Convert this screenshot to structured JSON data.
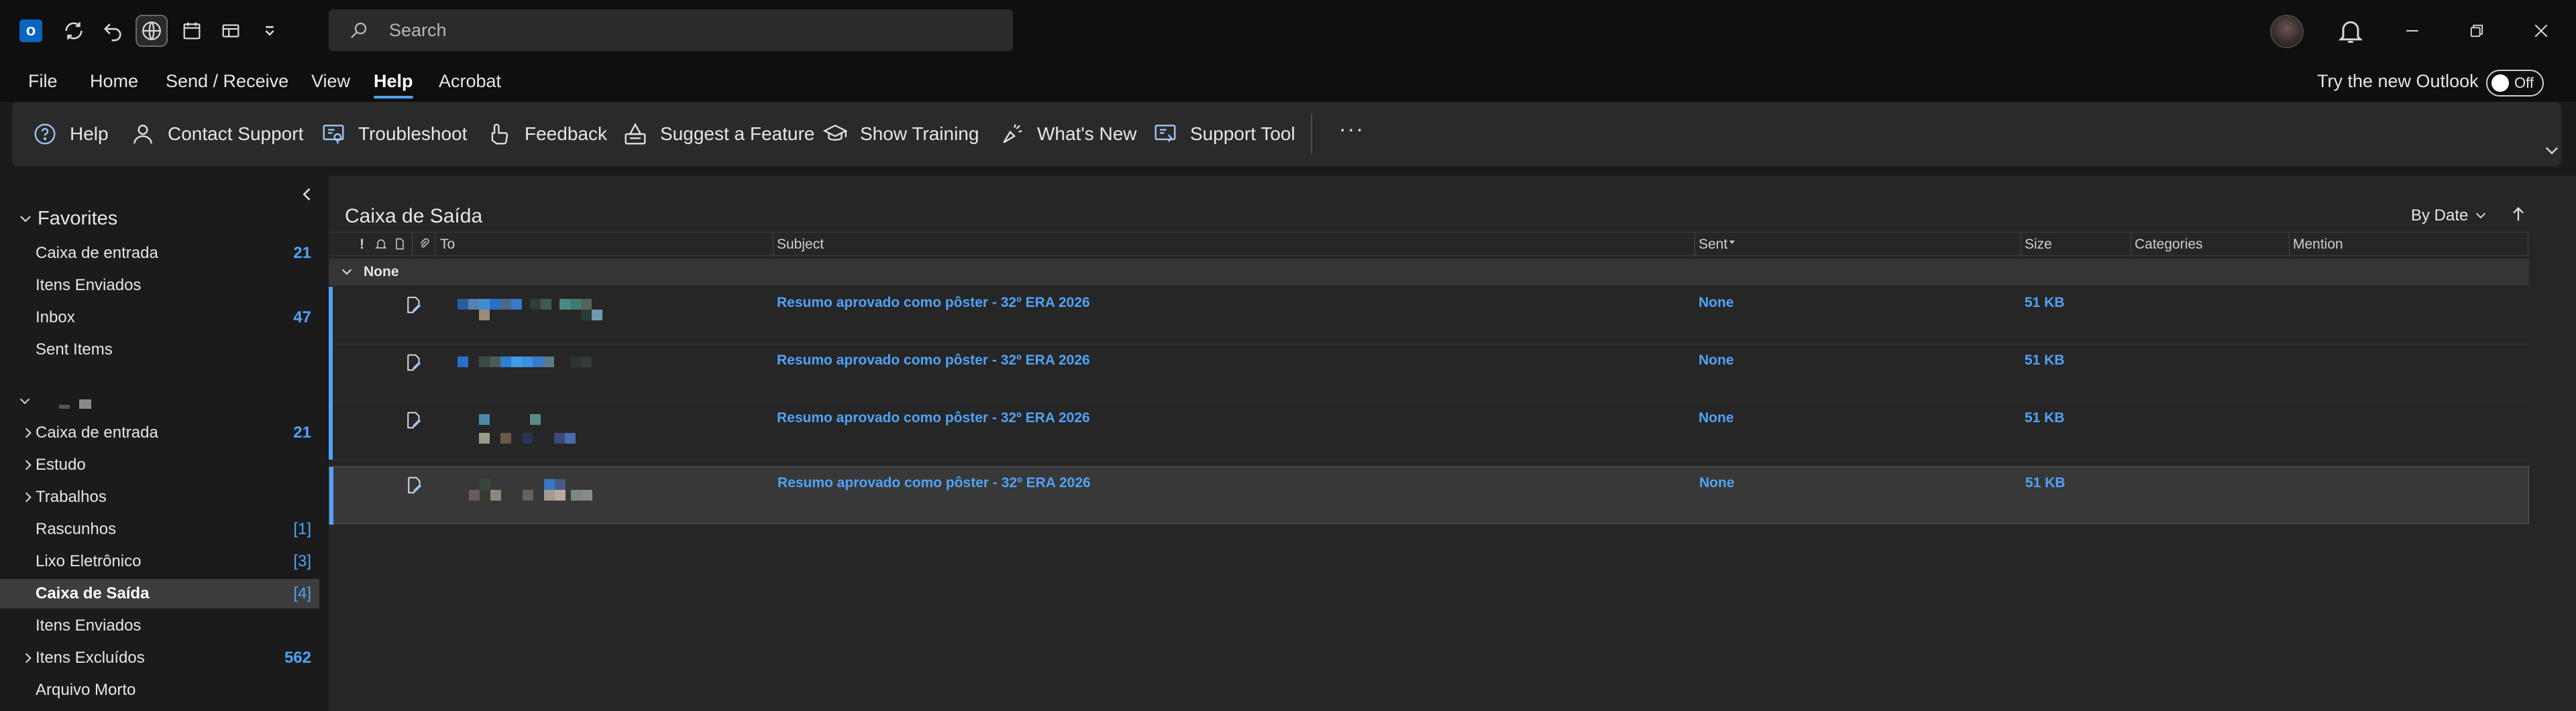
{
  "titlebar": {
    "search_placeholder": "Search"
  },
  "menu": {
    "items": [
      "File",
      "Home",
      "Send / Receive",
      "View",
      "Help",
      "Acrobat"
    ],
    "active": "Help",
    "try_new_label": "Try the new Outlook",
    "toggle_label": "Off"
  },
  "ribbon": {
    "buttons": [
      {
        "label": "Help",
        "icon": "help-circle-icon"
      },
      {
        "label": "Contact Support",
        "icon": "person-icon"
      },
      {
        "label": "Troubleshoot",
        "icon": "troubleshoot-icon"
      },
      {
        "label": "Feedback",
        "icon": "feedback-icon"
      },
      {
        "label": "Suggest a Feature",
        "icon": "suggest-feature-icon"
      },
      {
        "label": "Show Training",
        "icon": "graduation-cap-icon"
      },
      {
        "label": "What's New",
        "icon": "megaphone-icon"
      },
      {
        "label": "Support Tool",
        "icon": "support-tool-icon"
      }
    ],
    "more_label": "···"
  },
  "sidebar": {
    "favorites_label": "Favorites",
    "favorites": [
      {
        "label": "Caixa de entrada",
        "count": "21"
      },
      {
        "label": "Itens Enviados",
        "count": ""
      },
      {
        "label": "Inbox",
        "count": "47"
      },
      {
        "label": "Sent Items",
        "count": ""
      }
    ],
    "folders": [
      {
        "label": "Caixa de entrada",
        "count": "21",
        "expandable": true
      },
      {
        "label": "Estudo",
        "count": "",
        "expandable": true
      },
      {
        "label": "Trabalhos",
        "count": "",
        "expandable": true
      },
      {
        "label": "Rascunhos",
        "count": "[1]",
        "expandable": false
      },
      {
        "label": "Lixo Eletrônico",
        "count": "[3]",
        "expandable": false
      },
      {
        "label": "Caixa de Saída",
        "count": "[4]",
        "expandable": false,
        "selected": true
      },
      {
        "label": "Itens Enviados",
        "count": "",
        "expandable": false
      },
      {
        "label": "Itens Excluídos",
        "count": "562",
        "expandable": true
      },
      {
        "label": "Arquivo Morto",
        "count": "",
        "expandable": false
      }
    ]
  },
  "main": {
    "folder_title": "Caixa de Saída",
    "sort_label": "By Date",
    "columns": {
      "importance": "!",
      "to": "To",
      "subject": "Subject",
      "sent": "Sent",
      "size": "Size",
      "categories": "Categories",
      "mention": "Mention"
    },
    "group_label": "None",
    "messages": [
      {
        "subject": "Resumo aprovado como pôster - 32º ERA 2026",
        "sent": "None",
        "size": "51 KB"
      },
      {
        "subject": "Resumo aprovado como pôster - 32º ERA 2026",
        "sent": "None",
        "size": "51 KB"
      },
      {
        "subject": "Resumo aprovado como pôster - 32º ERA 2026",
        "sent": "None",
        "size": "51 KB"
      },
      {
        "subject": "Resumo aprovado como pôster - 32º ERA 2026",
        "sent": "None",
        "size": "51 KB"
      }
    ]
  },
  "colors": {
    "accent": "#4fa3f7",
    "background": "#1b1b1b",
    "ribbon": "#2a2a2a",
    "outlook_blue": "#0a64c2"
  }
}
